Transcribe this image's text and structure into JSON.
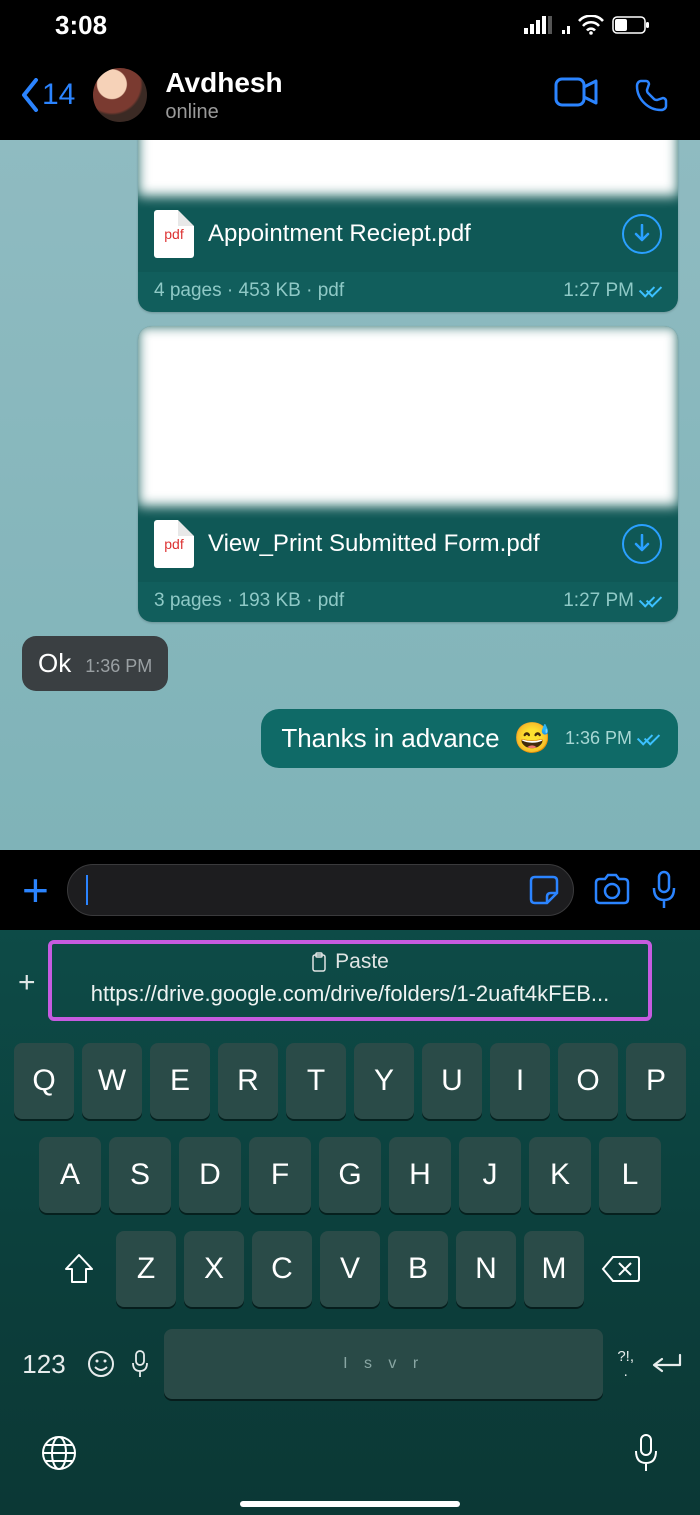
{
  "status": {
    "time": "3:08"
  },
  "header": {
    "back_count": "14",
    "name": "Avdhesh",
    "status": "online"
  },
  "docs": [
    {
      "filename": "Appointment Reciept.pdf",
      "pages": "4 pages",
      "size": "453 KB",
      "ext": "pdf",
      "time": "1:27 PM",
      "badge": "pdf"
    },
    {
      "filename": "View_Print Submitted Form.pdf",
      "pages": "3 pages",
      "size": "193 KB",
      "ext": "pdf",
      "time": "1:27 PM",
      "badge": "pdf"
    }
  ],
  "incoming": {
    "text": "Ok",
    "time": "1:36 PM"
  },
  "outgoing": {
    "text": "Thanks in advance",
    "emoji": "😅",
    "time": "1:36 PM"
  },
  "paste": {
    "label": "Paste",
    "url": "https://drive.google.com/drive/folders/1-2uaft4kFEB..."
  },
  "keyboard": {
    "row1": [
      "Q",
      "W",
      "E",
      "R",
      "T",
      "Y",
      "U",
      "I",
      "O",
      "P"
    ],
    "row2": [
      "A",
      "S",
      "D",
      "F",
      "G",
      "H",
      "J",
      "K",
      "L"
    ],
    "row3": [
      "Z",
      "X",
      "C",
      "V",
      "B",
      "N",
      "M"
    ],
    "numkey": "123",
    "punct": "?!,\n.",
    "space_hint": "I   s   v   r"
  }
}
